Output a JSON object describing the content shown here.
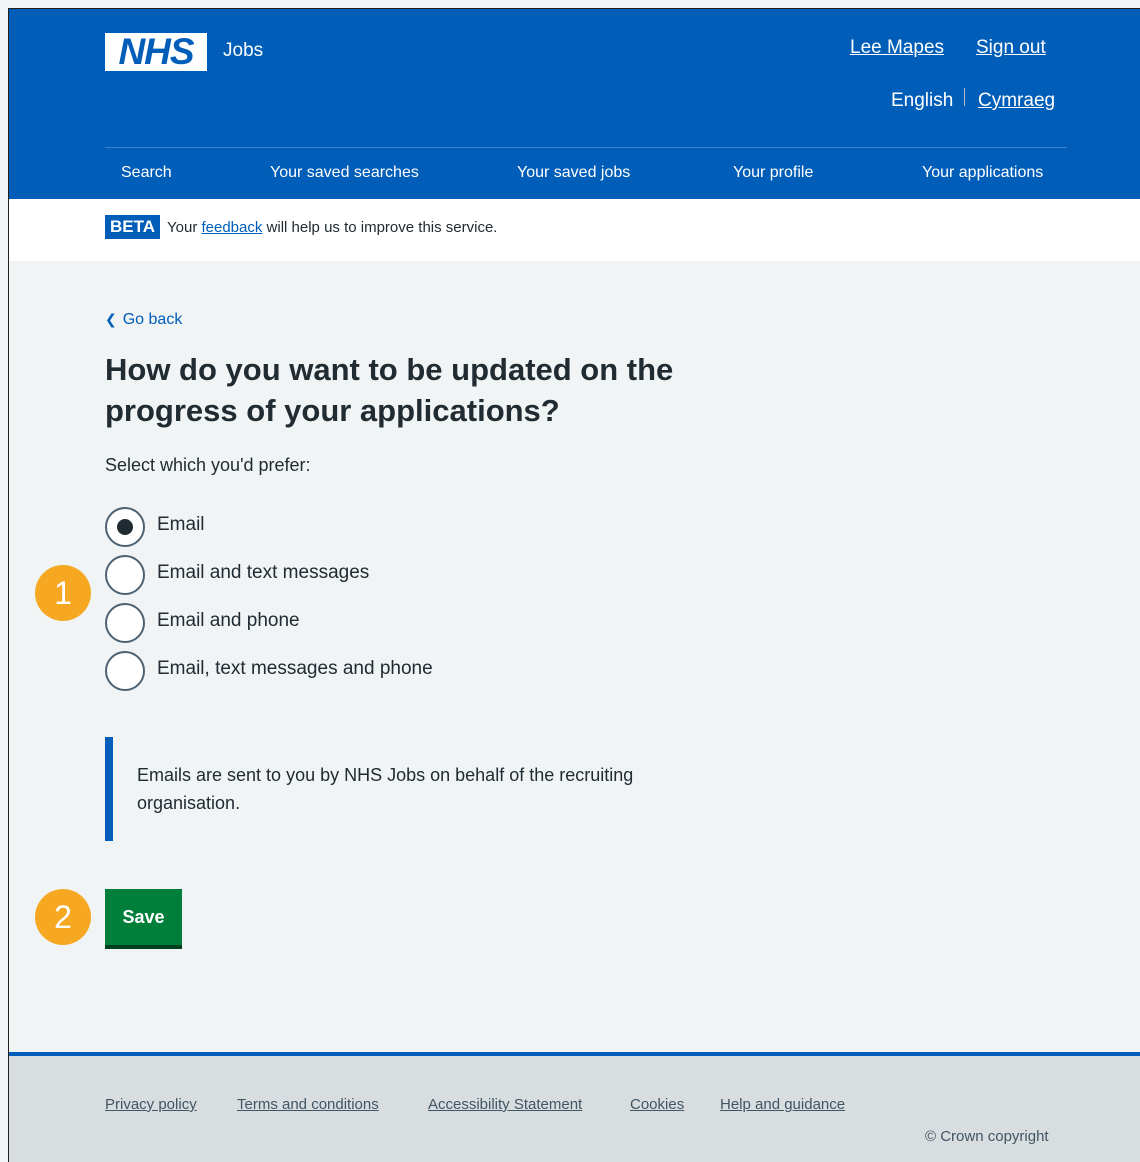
{
  "header": {
    "logo": "NHS",
    "service_name": "Jobs",
    "user_name": "Lee Mapes",
    "sign_out": "Sign out",
    "language_current": "English",
    "language_alt": "Cymraeg",
    "nav": [
      "Search",
      "Your saved searches",
      "Your saved jobs",
      "Your profile",
      "Your applications"
    ]
  },
  "beta": {
    "tag": "BETA",
    "text_before": "Your",
    "link": "feedback",
    "text_after": "will help us to improve this service."
  },
  "main": {
    "back_link": "Go back",
    "title": "How do you want to be updated on the progress of your applications?",
    "hint": "Select which you'd prefer:",
    "options": [
      {
        "label": "Email",
        "checked": true
      },
      {
        "label": "Email and text messages",
        "checked": false
      },
      {
        "label": "Email and phone",
        "checked": false
      },
      {
        "label": "Email, text messages and phone",
        "checked": false
      }
    ],
    "inset_text": "Emails are sent to you by NHS Jobs on behalf of the recruiting organisation.",
    "save_button": "Save"
  },
  "annotations": {
    "step1": "1",
    "step2": "2"
  },
  "footer": {
    "links": [
      "Privacy policy",
      "Terms and conditions",
      "Accessibility Statement",
      "Cookies",
      "Help and guidance"
    ],
    "copyright": "© Crown copyright"
  },
  "colors": {
    "nhs_blue": "#005eb8",
    "button_green": "#007f3b",
    "annotation_orange": "#f7a823",
    "page_background": "#f0f4f5"
  }
}
